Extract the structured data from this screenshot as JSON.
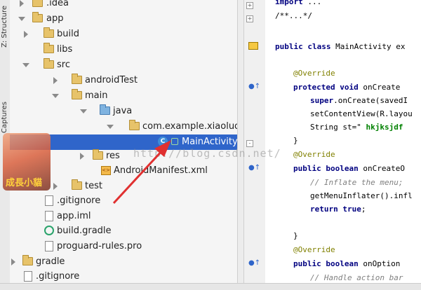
{
  "side_panel": {
    "structure_label": "Z: Structure",
    "captures_label": "Captures"
  },
  "project_tree": {
    "items": [
      {
        "label": ".idea",
        "icon": "folder-icon"
      },
      {
        "label": "app",
        "icon": "folder-icon"
      },
      {
        "label": "build",
        "icon": "folder-icon"
      },
      {
        "label": "libs",
        "icon": "folder-icon"
      },
      {
        "label": "src",
        "icon": "folder-icon"
      },
      {
        "label": "androidTest",
        "icon": "folder-icon"
      },
      {
        "label": "main",
        "icon": "folder-icon"
      },
      {
        "label": "java",
        "icon": "folder-icon"
      },
      {
        "label": "com.example.xiaoluo.r",
        "icon": "package-icon"
      },
      {
        "label": "MainActivity",
        "icon": "class-icon"
      },
      {
        "label": "res",
        "icon": "folder-icon"
      },
      {
        "label": "AndroidManifest.xml",
        "icon": "xml-file-icon"
      },
      {
        "label": "test",
        "icon": "folder-icon"
      },
      {
        "label": ".gitignore",
        "icon": "file-icon"
      },
      {
        "label": "app.iml",
        "icon": "file-icon"
      },
      {
        "label": "build.gradle",
        "icon": "gradle-icon"
      },
      {
        "label": "proguard-rules.pro",
        "icon": "file-icon"
      },
      {
        "label": "gradle",
        "icon": "folder-icon"
      },
      {
        "label": ".gitignore",
        "icon": "file-icon"
      }
    ],
    "avatar_text": "成長小貓"
  },
  "editor": {
    "lines": [
      {
        "kw": "import",
        "rest": " ..."
      },
      {
        "kw": "",
        "rest": "/**...*/"
      },
      {
        "kw": "public class",
        "rest": " MainActivity ex"
      },
      {
        "kw": "",
        "rest": "@Override"
      },
      {
        "kw": "protected void",
        "rest": " onCreate"
      },
      {
        "kw": "super",
        "rest": ".onCreate(savedI"
      },
      {
        "kw": "",
        "rest": "setContentView(R.layou"
      },
      {
        "kw": "",
        "rest": "String st=\" ",
        "str": "hkjksjdf"
      },
      {
        "kw": "",
        "rest": "}"
      },
      {
        "kw": "",
        "rest": "@Override"
      },
      {
        "kw": "public boolean",
        "rest": " onCreateO"
      },
      {
        "kw": "",
        "rest": "// Inflate the menu;"
      },
      {
        "kw": "",
        "rest": "getMenuInflater().infl"
      },
      {
        "kw": "return true",
        "rest": ";"
      },
      {
        "kw": "",
        "rest": "}"
      },
      {
        "kw": "",
        "rest": "@Override"
      },
      {
        "kw": "public boolean",
        "rest": " onOption"
      },
      {
        "kw": "",
        "rest": "// Handle action bar"
      }
    ]
  },
  "watermark": "http://blog.csdn.net/",
  "colors": {
    "selection": "#2f65ca",
    "arrow": "#e03030"
  }
}
